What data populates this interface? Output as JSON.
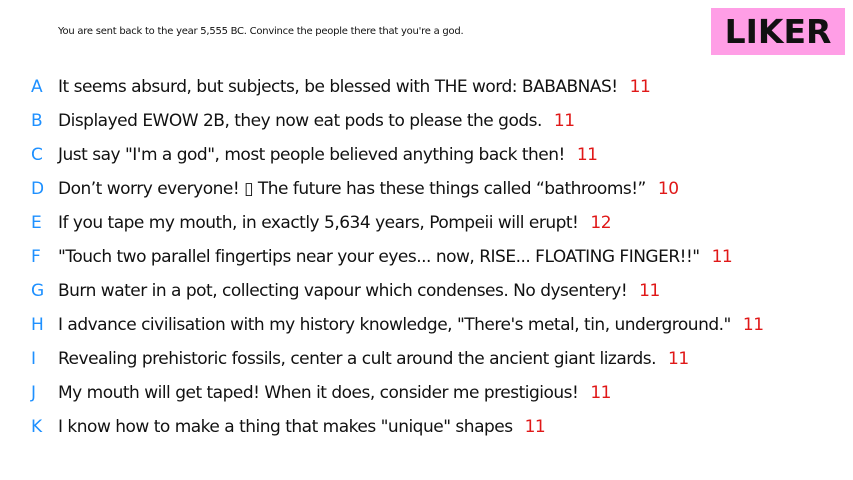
{
  "prompt": "You are sent back to the year 5,555 BC. Convince the people there that you're a god.",
  "badge": {
    "label": "LIKER",
    "color": "#ff9ee6"
  },
  "colors": {
    "letter": "#1e90ff",
    "score": "#e01818"
  },
  "entries": [
    {
      "letter": "A",
      "text": "It seems absurd, but subjects, be blessed with THE word: BABABNAS!",
      "score": "11"
    },
    {
      "letter": "B",
      "text": "Displayed EWOW 2B, they now eat pods to please the gods.",
      "score": "11"
    },
    {
      "letter": "C",
      "text": "Just say \"I'm a god\", most people believed anything back then!",
      "score": "11"
    },
    {
      "letter": "D",
      "text": "Don’t worry everyone! ▯ The future has these things called “bathrooms!”",
      "score": "10"
    },
    {
      "letter": "E",
      "text": "If you tape my mouth, in exactly 5,634 years, Pompeii will erupt!",
      "score": "12"
    },
    {
      "letter": "F",
      "text": "\"Touch two parallel fingertips near your eyes... now, RISE... FLOATING FINGER!!\"",
      "score": "11"
    },
    {
      "letter": "G",
      "text": "Burn water in a pot, collecting vapour which condenses. No dysentery!",
      "score": "11"
    },
    {
      "letter": "H",
      "text": "I advance civilisation with my history knowledge, \"There's metal, tin, underground.\"",
      "score": "11"
    },
    {
      "letter": "I",
      "text": "Revealing prehistoric fossils, center a cult around the ancient giant lizards.",
      "score": "11"
    },
    {
      "letter": "J",
      "text": "My mouth will get taped! When it does, consider me prestigious!",
      "score": "11"
    },
    {
      "letter": "K",
      "text": "I know how to make a thing that makes \"unique\" shapes",
      "score": "11"
    }
  ]
}
